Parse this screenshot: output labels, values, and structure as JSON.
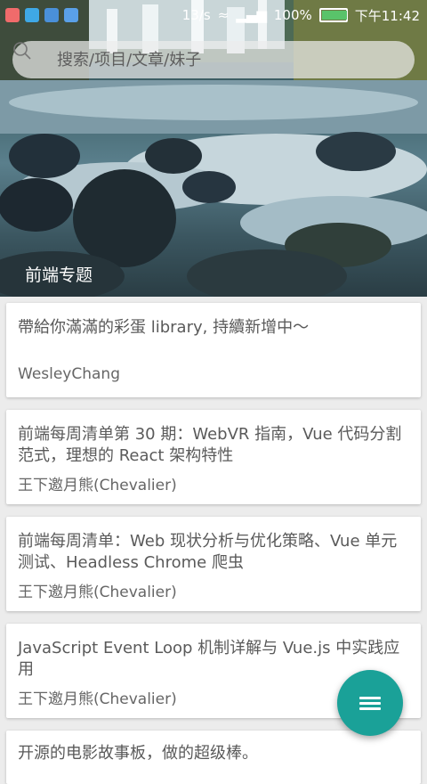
{
  "status_bar": {
    "speed": "13/s",
    "battery": "100%",
    "time": "下午11:42"
  },
  "search": {
    "placeholder": "搜索/项目/文章/妹子"
  },
  "hero": {
    "caption": "前端专题"
  },
  "articles": [
    {
      "title": "帶給你滿滿的彩蛋 library, 持續新增中～",
      "author": "WesleyChang"
    },
    {
      "title": "前端每周清单第 30 期：WebVR 指南，Vue 代码分割范式，理想的 React 架构特性",
      "author": "王下邀月熊(Chevalier)"
    },
    {
      "title": "前端每周清单：Web 现状分析与优化策略、Vue 单元测试、Headless Chrome 爬虫",
      "author": "王下邀月熊(Chevalier)"
    },
    {
      "title": "JavaScript Event Loop 机制详解与 Vue.js 中实践应用",
      "author": "王下邀月熊(Chevalier)"
    },
    {
      "title": "开源的电影故事板，做的超级棒。",
      "author": ""
    }
  ],
  "colors": {
    "accent": "#1aa198"
  },
  "fab": {
    "icon": "menu-icon"
  }
}
